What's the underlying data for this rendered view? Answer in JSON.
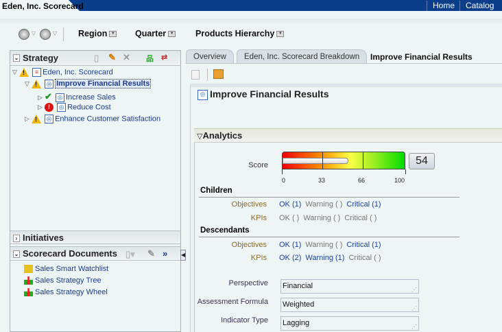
{
  "app": {
    "title": "Eden, Inc. Scorecard",
    "links": [
      "Home",
      "Catalog"
    ]
  },
  "toolbar": {
    "menus": [
      "Region",
      "Quarter",
      "Products Hierarchy"
    ]
  },
  "strategy": {
    "title": "Strategy",
    "tree": [
      {
        "label": "Eden, Inc. Scorecard",
        "status": "warning"
      },
      {
        "label": "Improve Financial Results",
        "status": "warning",
        "selected": true
      },
      {
        "label": "Increase Sales",
        "status": "ok"
      },
      {
        "label": "Reduce Cost",
        "status": "critical"
      },
      {
        "label": "Enhance Customer Satisfaction",
        "status": "warning"
      }
    ]
  },
  "initiatives": {
    "title": "Initiatives"
  },
  "documents": {
    "title": "Scorecard Documents",
    "items": [
      "Sales Smart Watchlist",
      "Sales Strategy Tree",
      "Sales Strategy Wheel"
    ]
  },
  "tabs": [
    "Overview",
    "Eden, Inc. Scorecard Breakdown",
    "Improve Financial Results"
  ],
  "main": {
    "title": "Improve Financial Results",
    "section": "Analytics",
    "score": {
      "label": "Score",
      "value": "54",
      "fraction": 0.54,
      "ticks": [
        "0",
        "33",
        "66",
        "100"
      ]
    },
    "children": {
      "title": "Children",
      "objectives_label": "Objectives",
      "kpis_label": "KPIs",
      "objectives": [
        "OK (1)",
        "Warning ( )",
        "Critical (1)"
      ],
      "kpis": [
        "OK ( )",
        "Warning ( )",
        "Critical ( )"
      ]
    },
    "descendants": {
      "title": "Descendants",
      "objectives_label": "Objectives",
      "kpis_label": "KPIs",
      "objectives": [
        "OK (1)",
        "Warning ( )",
        "Critical (1)"
      ],
      "kpis": [
        "OK (2)",
        "Warning (1)",
        "Critical ( )"
      ]
    },
    "fields": [
      {
        "label": "Perspective",
        "value": "Financial"
      },
      {
        "label": "Assessment Formula",
        "value": "Weighted"
      },
      {
        "label": "Indicator Type",
        "value": "Lagging"
      }
    ]
  }
}
